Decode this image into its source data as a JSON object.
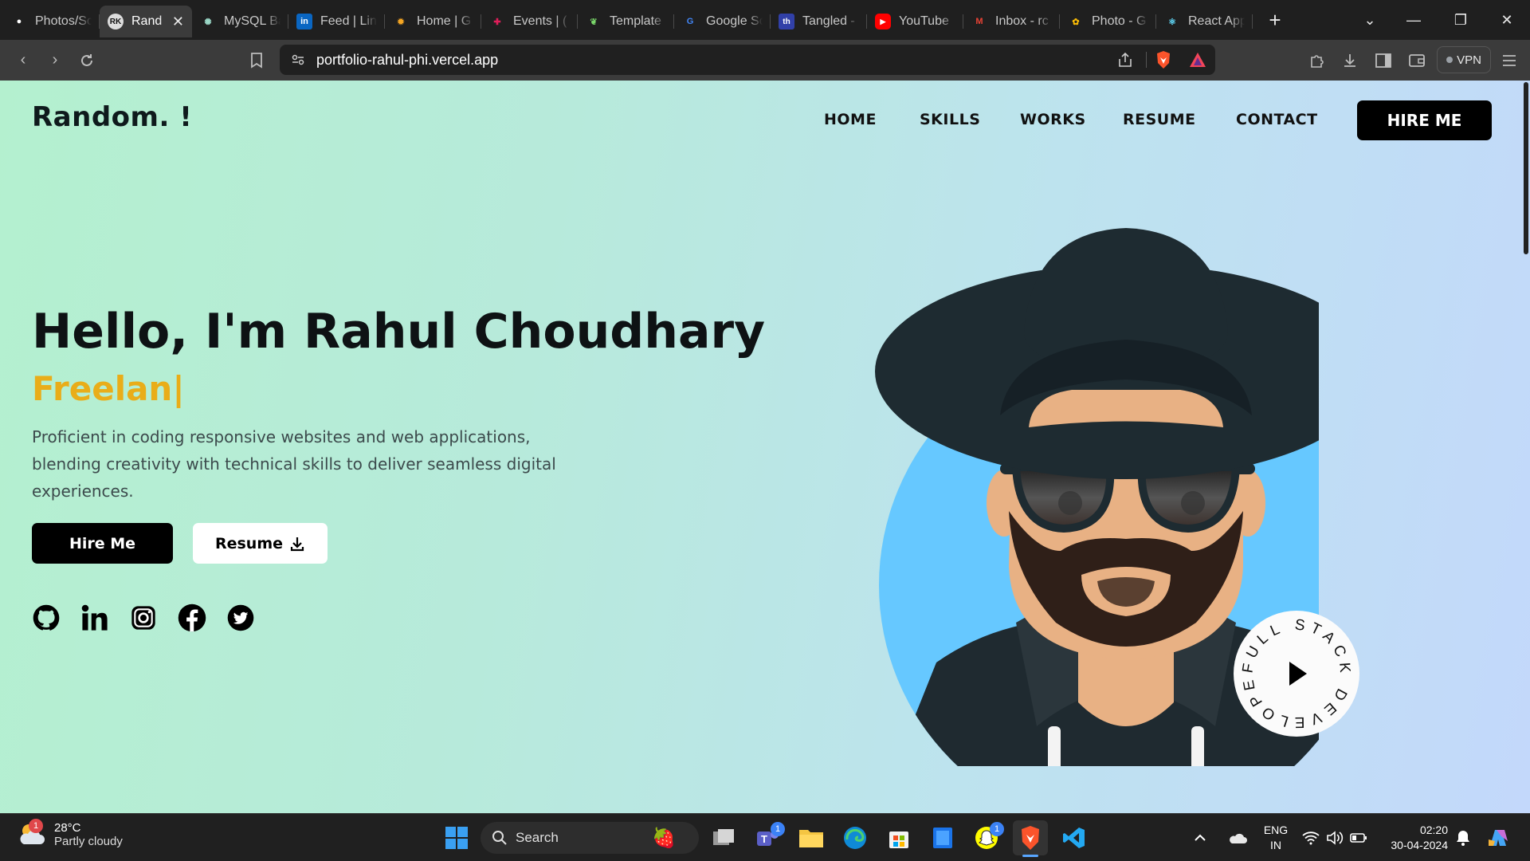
{
  "browser": {
    "tabs": [
      {
        "title": "Photos/Sc",
        "icon": "github-icon",
        "color": "#ffffff"
      },
      {
        "title": "Rand",
        "icon": "rk-icon",
        "color": "#ffffff",
        "active": true
      },
      {
        "title": "MySQL Ba",
        "icon": "chatgpt-icon",
        "color": "#9ad7c6"
      },
      {
        "title": "Feed | Lin",
        "icon": "linkedin-icon",
        "color": "#0a66c2"
      },
      {
        "title": "Home | G",
        "icon": "gear-sun-icon",
        "color": "#f5a623"
      },
      {
        "title": "Events | (",
        "icon": "slack-icon",
        "color": "#e01e5a"
      },
      {
        "title": "Template",
        "icon": "leaf-icon",
        "color": "#7bd86b"
      },
      {
        "title": "Google Sc",
        "icon": "google-icon",
        "color": "#4285f4"
      },
      {
        "title": "Tangled -",
        "icon": "th-icon",
        "color": "#3140a8"
      },
      {
        "title": "YouTube",
        "icon": "youtube-icon",
        "color": "#ff0000"
      },
      {
        "title": "Inbox - rc",
        "icon": "gmail-icon",
        "color": "#ea4335"
      },
      {
        "title": "Photo - G",
        "icon": "google-photos-icon",
        "color": "#fbbc05"
      },
      {
        "title": "React App",
        "icon": "react-icon",
        "color": "#61dafb"
      }
    ],
    "url": "portfolio-rahul-phi.vercel.app",
    "vpn_label": "VPN"
  },
  "site": {
    "logo": "Random. !",
    "nav": [
      "HOME",
      "SKILLS",
      "WORKS",
      "RESUME",
      "CONTACT"
    ],
    "hire_top": "HIRE ME",
    "hero": {
      "title": "Hello, I'm Rahul Choudhary",
      "typed": "Freelan|",
      "description": "Proficient in coding responsive websites and web applications, blending creativity with technical skills to deliver seamless digital experiences.",
      "btn_hire": "Hire Me",
      "btn_resume": "Resume"
    },
    "socials": [
      "github-icon",
      "linkedin-icon",
      "instagram-icon",
      "facebook-icon",
      "twitter-icon"
    ],
    "badge_text": "FULL STACK DEVELOPER•",
    "accent": "#e9ad19"
  },
  "taskbar": {
    "weather_temp": "28°C",
    "weather_desc": "Partly cloudy",
    "weather_badge": "1",
    "search_placeholder": "Search",
    "lang_line1": "ENG",
    "lang_line2": "IN",
    "time": "02:20",
    "date": "30-04-2024",
    "teams_badge": "1",
    "snap_badge": "1"
  }
}
